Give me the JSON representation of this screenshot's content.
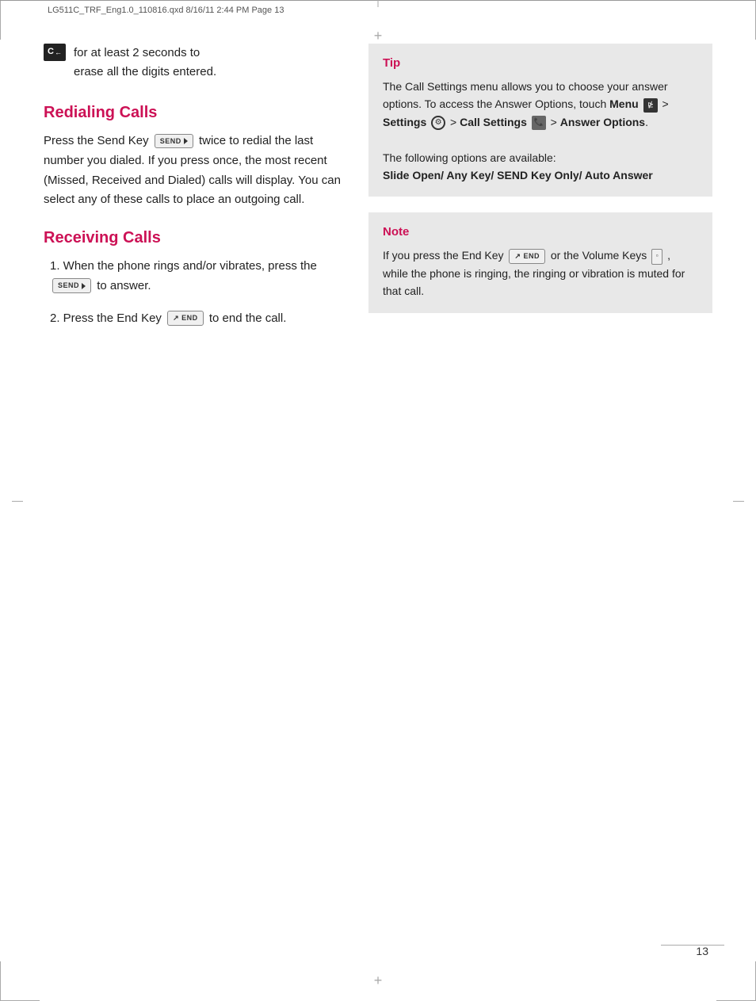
{
  "header": {
    "text": "LG511C_TRF_Eng1.0_110816.qxd   8/16/11   2:44 PM   Page 13"
  },
  "intro": {
    "icon_label": "C",
    "text1": "for at least 2 seconds to",
    "text2": "erase all the digits entered."
  },
  "redialing": {
    "heading": "Redialing Calls",
    "body": "twice to redial the last number you dialed. If you press once, the most recent (Missed, Received and Dialed) calls will display. You can select any of these calls to place an outgoing call."
  },
  "receiving": {
    "heading": "Receiving Calls",
    "item1_prefix": "1. When the phone rings and/or vibrates, press the",
    "item1_suffix": "to answer.",
    "item2_prefix": "2. Press the End Key",
    "item2_suffix": "to end the call."
  },
  "tip": {
    "title": "Tip",
    "body": "The Call Settings menu allows you to choose your answer options. To access the Answer Options, touch Menu > Settings > Call Settings > Answer Options.",
    "options_label": "The following options are available:",
    "options_text": "Slide Open/ Any Key/ SEND Key Only/ Auto Answer"
  },
  "note": {
    "title": "Note",
    "body1": "If you press the End Key",
    "body2": "or the Volume Keys",
    "body3": ", while the phone is ringing, the ringing or vibration is muted for that call."
  },
  "page_number": "13",
  "send_key_label": "SEND",
  "end_key_label": "END"
}
